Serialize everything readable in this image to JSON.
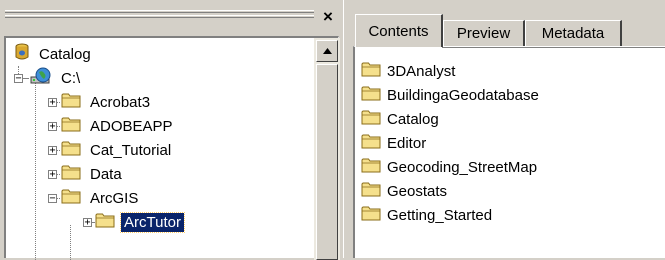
{
  "catalog_tree": {
    "close_glyph": "×",
    "items": [
      {
        "label": "Catalog",
        "icon": "catalog-icon",
        "level": 0,
        "expander": "none"
      },
      {
        "label": "C:\\",
        "icon": "drive-icon",
        "level": 1,
        "expander": "minus"
      },
      {
        "label": "Acrobat3",
        "icon": "folder-icon",
        "level": 2,
        "expander": "plus"
      },
      {
        "label": "ADOBEAPP",
        "icon": "folder-icon",
        "level": 2,
        "expander": "plus"
      },
      {
        "label": "Cat_Tutorial",
        "icon": "folder-icon",
        "level": 2,
        "expander": "plus"
      },
      {
        "label": "Data",
        "icon": "folder-icon",
        "level": 2,
        "expander": "plus"
      },
      {
        "label": "ArcGIS",
        "icon": "folder-icon",
        "level": 2,
        "expander": "minus"
      },
      {
        "label": "ArcTutor",
        "icon": "folder-icon",
        "level": 3,
        "expander": "plus",
        "selected": true
      }
    ]
  },
  "tabs": [
    {
      "label": "Contents",
      "active": true
    },
    {
      "label": "Preview",
      "active": false
    },
    {
      "label": "Metadata",
      "active": false
    }
  ],
  "contents": {
    "items": [
      {
        "label": "3DAnalyst",
        "icon": "folder-icon"
      },
      {
        "label": "BuildingaGeodatabase",
        "icon": "folder-icon"
      },
      {
        "label": "Catalog",
        "icon": "folder-icon"
      },
      {
        "label": "Editor",
        "icon": "folder-icon"
      },
      {
        "label": "Geocoding_StreetMap",
        "icon": "folder-icon"
      },
      {
        "label": "Geostats",
        "icon": "folder-icon"
      },
      {
        "label": "Getting_Started",
        "icon": "folder-icon"
      }
    ]
  },
  "colors": {
    "window_face": "#d4d0c8",
    "selection": "#0a246a",
    "folder_fill": "#f5e08c",
    "folder_stroke": "#8a6d1a"
  }
}
